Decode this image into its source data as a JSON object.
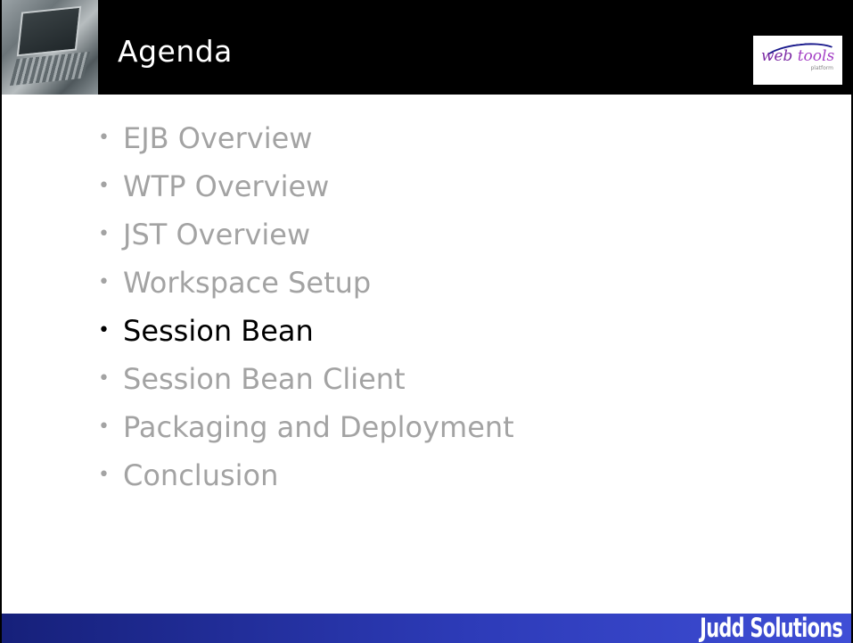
{
  "header": {
    "title": "Agenda",
    "laptop_image": "laptop-photo",
    "logo": {
      "text_web": "web ",
      "text_tools": "tools",
      "subtext": "platform"
    }
  },
  "agenda": {
    "bullet": "•",
    "items": [
      {
        "label": "EJB Overview",
        "current": false
      },
      {
        "label": "WTP Overview",
        "current": false
      },
      {
        "label": "JST Overview",
        "current": false
      },
      {
        "label": "Workspace Setup",
        "current": false
      },
      {
        "label": "Session Bean",
        "current": true
      },
      {
        "label": "Session Bean Client",
        "current": false
      },
      {
        "label": "Packaging and Deployment",
        "current": false
      },
      {
        "label": "Conclusion",
        "current": false
      }
    ]
  },
  "footer": {
    "brand": "Judd Solutions"
  },
  "colors": {
    "header_bg": "#000000",
    "footer_start": "#16207a",
    "footer_end": "#3f4ed6",
    "inactive_text": "#a3a3a3",
    "active_text": "#000000"
  }
}
